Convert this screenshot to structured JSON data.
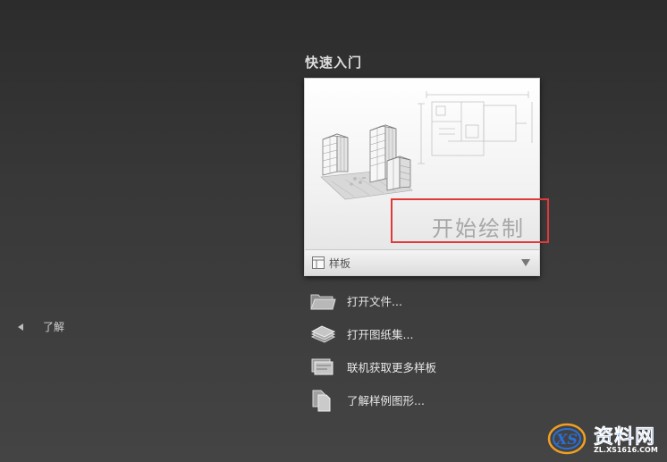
{
  "nav": {
    "learn_label": "了解"
  },
  "quick_start": {
    "title": "快速入门",
    "start_drawing_label": "开始绘制",
    "template_label": "样板"
  },
  "actions": [
    {
      "label": "打开文件...",
      "icon": "folder-icon"
    },
    {
      "label": "打开图纸集...",
      "icon": "sheet-set-icon"
    },
    {
      "label": "联机获取更多样板",
      "icon": "online-templates-icon"
    },
    {
      "label": "了解样例图形...",
      "icon": "sample-drawings-icon"
    }
  ],
  "watermark": {
    "title": "资料网",
    "url": "ZL.XS1616.COM"
  },
  "colors": {
    "background_top": "#2c2c2c",
    "background_bottom": "#444444",
    "highlight": "#e0393a",
    "watermark_blue": "#2b6fd6"
  }
}
